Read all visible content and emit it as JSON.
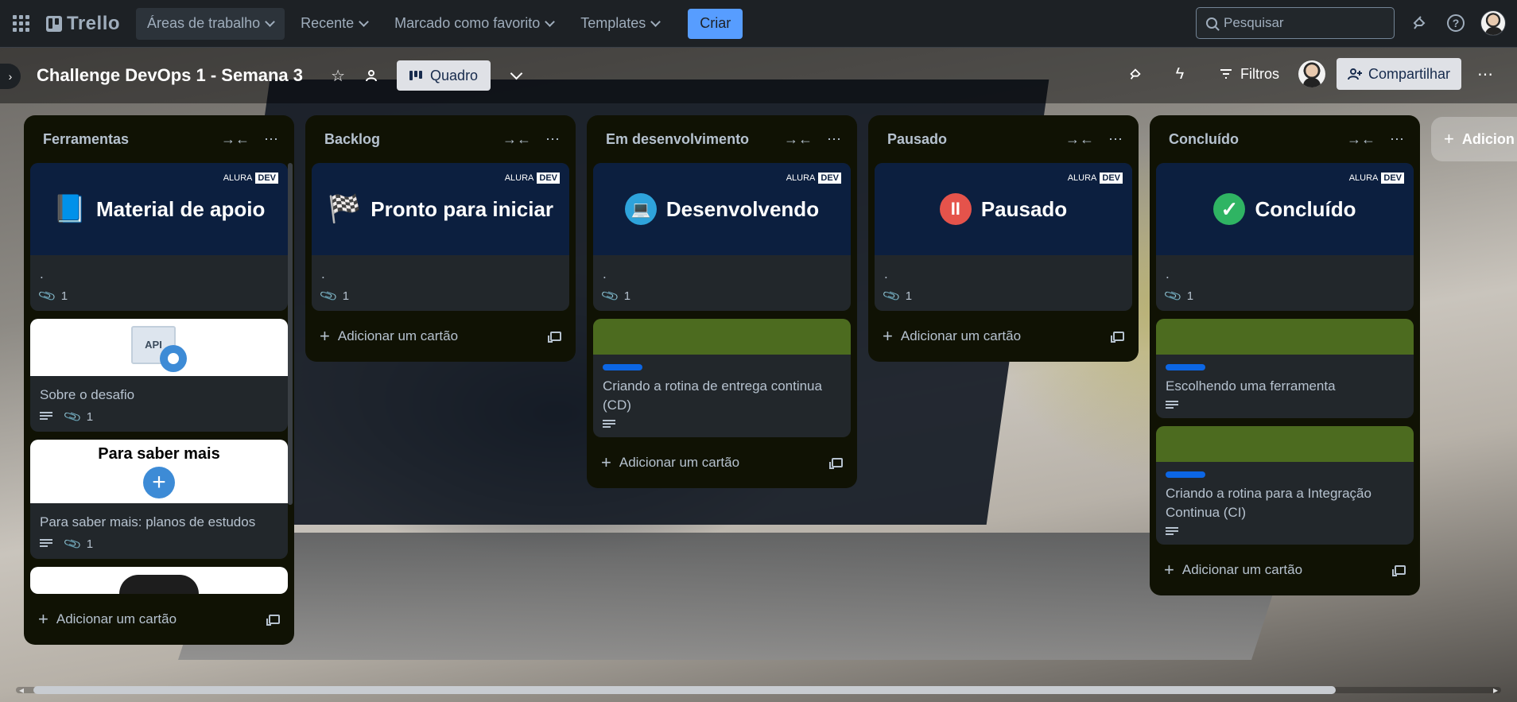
{
  "topbar": {
    "logo": "Trello",
    "nav": [
      {
        "label": "Áreas de trabalho"
      },
      {
        "label": "Recente"
      },
      {
        "label": "Marcado como favorito"
      },
      {
        "label": "Templates"
      }
    ],
    "create_label": "Criar",
    "search_placeholder": "Pesquisar"
  },
  "board": {
    "title": "Challenge DevOps 1 - Semana 3",
    "view_label": "Quadro",
    "filter_label": "Filtros",
    "share_label": "Compartilhar",
    "add_list_label": "Adicion",
    "add_card_label": "Adicionar um cartão"
  },
  "lists": [
    {
      "title": "Ferramentas",
      "cover_card": {
        "brand": "ALURA",
        "brand_badge": "DEV",
        "emoji": "📘",
        "cover_title": "Material de apoio",
        "title": ".",
        "attachments": "1"
      },
      "cards": [
        {
          "api_label": "API",
          "title": "Sobre o desafio",
          "attachments": "1"
        },
        {
          "cover_title": "Para saber mais",
          "title": "Para saber mais: planos de estudos",
          "attachments": "1"
        }
      ]
    },
    {
      "title": "Backlog",
      "cover_card": {
        "brand": "ALURA",
        "brand_badge": "DEV",
        "emoji": "🏁",
        "cover_title": "Pronto para iniciar",
        "title": ".",
        "attachments": "1"
      }
    },
    {
      "title": "Em desenvolvimento",
      "cover_card": {
        "brand": "ALURA",
        "brand_badge": "DEV",
        "emoji": "💻",
        "cover_title": "Desenvolvendo",
        "title": ".",
        "attachments": "1"
      },
      "cards": [
        {
          "title": "Criando a rotina de entrega continua (CD)"
        }
      ]
    },
    {
      "title": "Pausado",
      "cover_card": {
        "brand": "ALURA",
        "brand_badge": "DEV",
        "emoji": "II",
        "cover_title": "Pausado",
        "title": ".",
        "attachments": "1"
      }
    },
    {
      "title": "Concluído",
      "cover_card": {
        "brand": "ALURA",
        "brand_badge": "DEV",
        "emoji": "✓",
        "cover_title": "Concluído",
        "title": ".",
        "attachments": "1"
      },
      "cards": [
        {
          "title": "Escolhendo uma ferramenta"
        },
        {
          "title": "Criando a rotina para a Integração Continua (CI)"
        }
      ]
    }
  ],
  "colors": {
    "accent": "#579dff",
    "cover_dark": "#0c1f3f",
    "cover_green": "#4c6b1f",
    "label_blue": "#0c66e4",
    "pause_red": "#e5534b",
    "check_green": "#2fb463",
    "dev_blue": "#2ea3db"
  }
}
